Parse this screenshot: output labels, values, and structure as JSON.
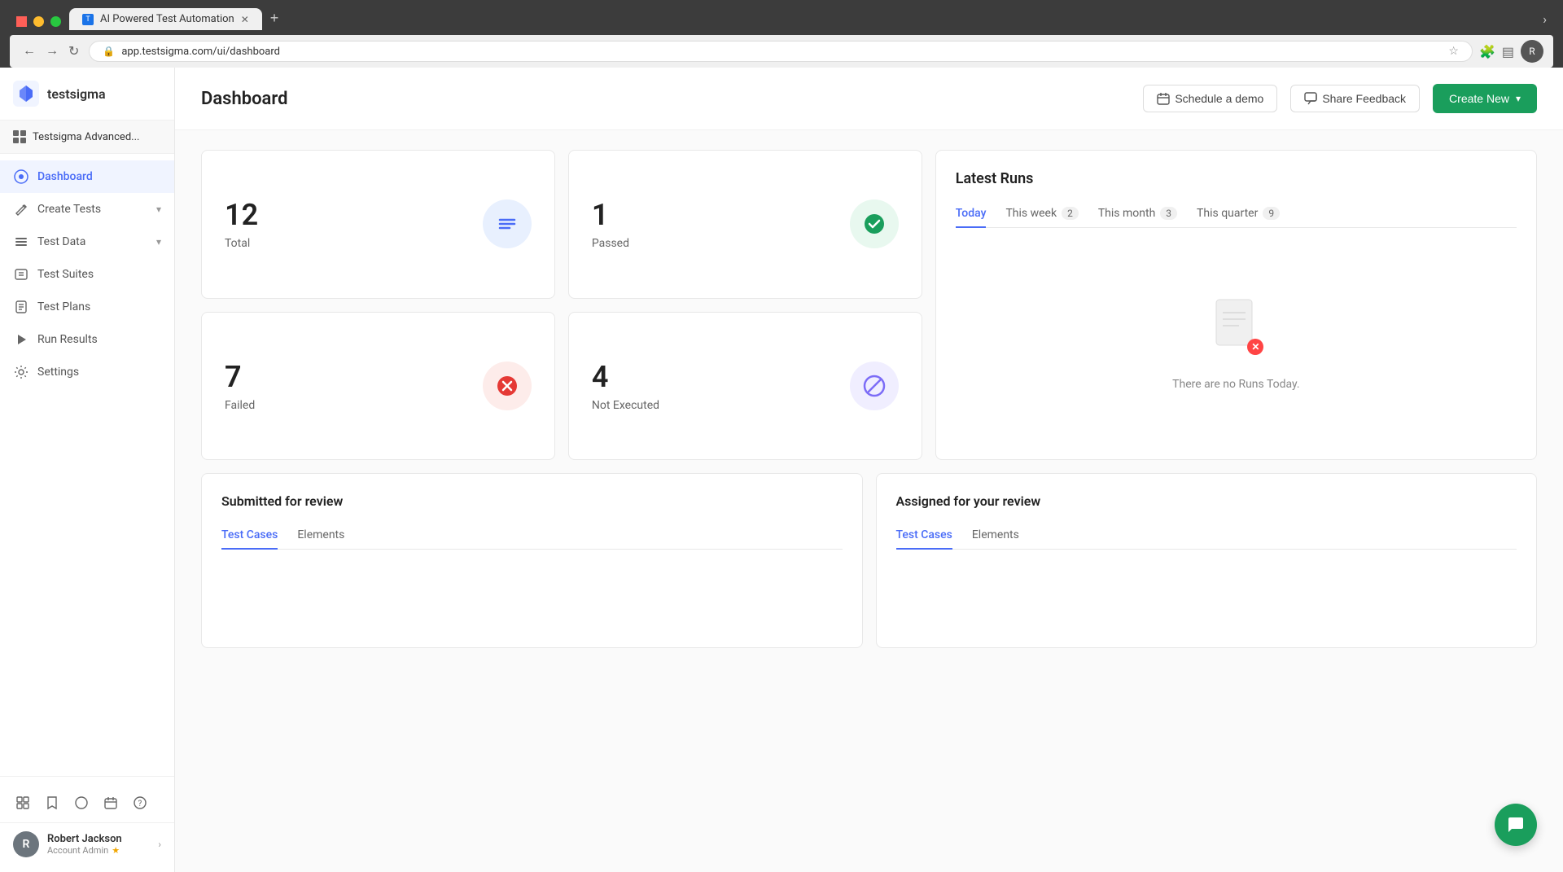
{
  "browser": {
    "tab_title": "AI Powered Test Automation",
    "url": "app.testsigma.com/ui/dashboard",
    "tab_new": "+",
    "tab_arrow": "›"
  },
  "sidebar": {
    "logo_text": "testsigma",
    "workspace_name": "Testsigma Advanced...",
    "nav_items": [
      {
        "id": "dashboard",
        "label": "Dashboard",
        "icon": "⊙",
        "active": true
      },
      {
        "id": "create-tests",
        "label": "Create Tests",
        "icon": "✏",
        "has_arrow": true
      },
      {
        "id": "test-data",
        "label": "Test Data",
        "icon": "≡",
        "has_arrow": true
      },
      {
        "id": "test-suites",
        "label": "Test Suites",
        "icon": "☰",
        "has_arrow": false
      },
      {
        "id": "test-plans",
        "label": "Test Plans",
        "icon": "📋",
        "has_arrow": false
      },
      {
        "id": "run-results",
        "label": "Run Results",
        "icon": "▶",
        "has_arrow": false
      },
      {
        "id": "settings",
        "label": "Settings",
        "icon": "⚙",
        "has_arrow": false
      }
    ],
    "user": {
      "name": "Robert Jackson",
      "role": "Account Admin",
      "avatar": "R"
    }
  },
  "header": {
    "title": "Dashboard",
    "schedule_btn": "Schedule a demo",
    "feedback_btn": "Share Feedback",
    "create_btn": "Create New"
  },
  "stats": [
    {
      "number": "12",
      "label": "Total",
      "icon_color": "blue",
      "icon": "≡"
    },
    {
      "number": "1",
      "label": "Passed",
      "icon_color": "green",
      "icon": "✓"
    },
    {
      "number": "7",
      "label": "Failed",
      "icon_color": "red",
      "icon": "✕"
    },
    {
      "number": "4",
      "label": "Not Executed",
      "icon_color": "purple",
      "icon": "⊘"
    }
  ],
  "latest_runs": {
    "title": "Latest Runs",
    "tabs": [
      {
        "label": "Today",
        "badge": null,
        "active": true
      },
      {
        "label": "This week",
        "badge": "2",
        "active": false
      },
      {
        "label": "This month",
        "badge": "3",
        "active": false
      },
      {
        "label": "This quarter",
        "badge": "9",
        "active": false
      }
    ],
    "empty_message": "There are no Runs Today."
  },
  "submitted_review": {
    "title": "Submitted for review",
    "tabs": [
      {
        "label": "Test Cases",
        "active": true
      },
      {
        "label": "Elements",
        "active": false
      }
    ]
  },
  "assigned_review": {
    "title": "Assigned for your review",
    "tabs": [
      {
        "label": "Test Cases",
        "active": true
      },
      {
        "label": "Elements",
        "active": false
      }
    ]
  }
}
